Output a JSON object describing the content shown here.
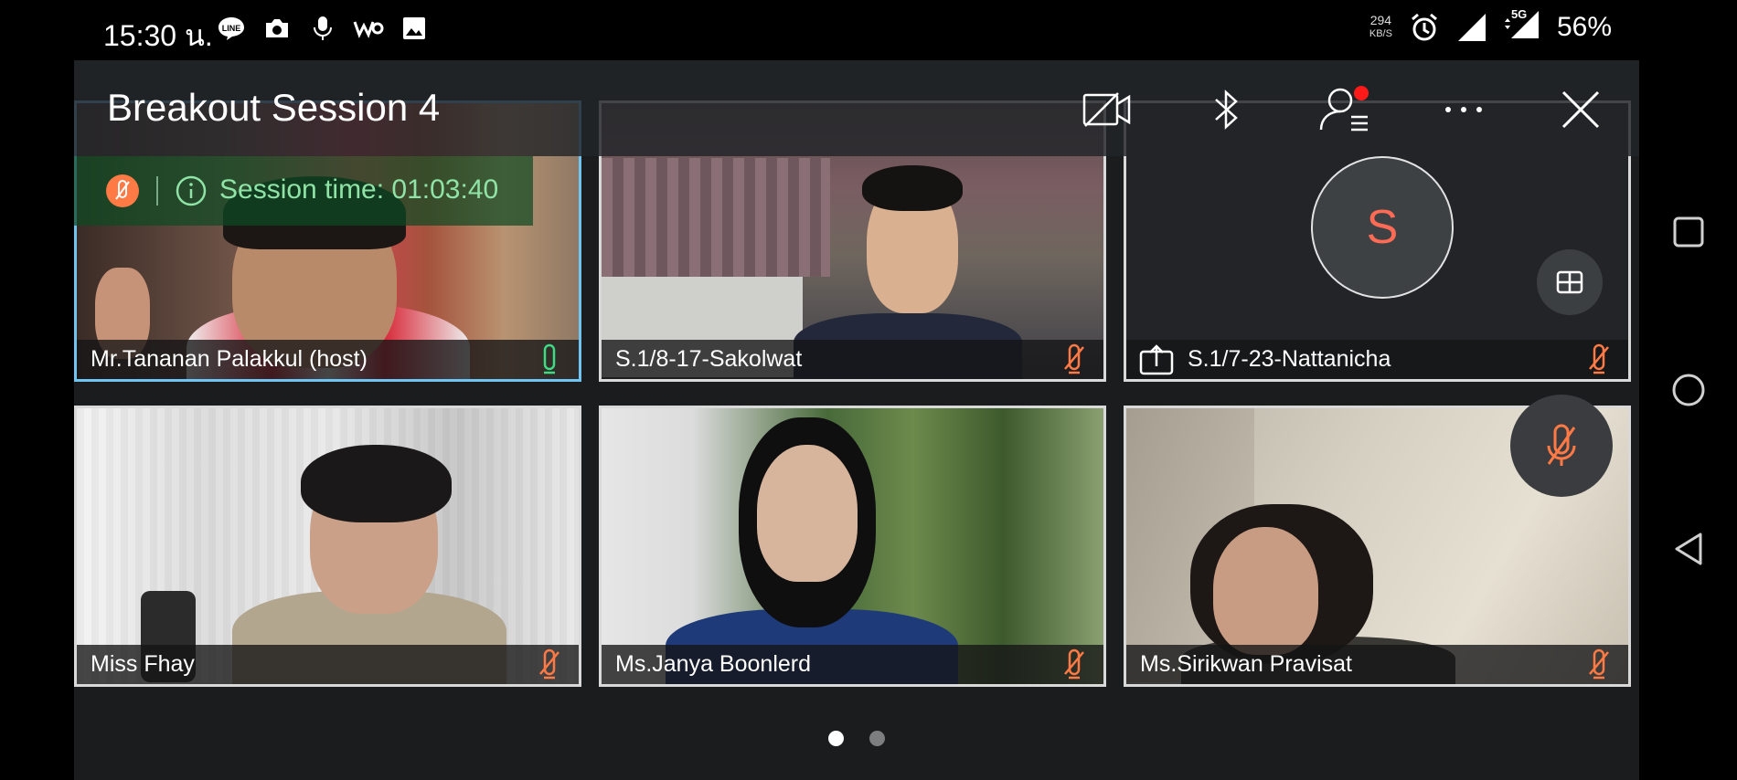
{
  "status_bar": {
    "time": "15:30 น.",
    "net_speed_value": "294",
    "net_speed_unit": "KB/S",
    "network": "5G",
    "battery": "56%",
    "icons": [
      "line-app-icon",
      "camera-icon",
      "microphone-icon",
      "webex-icon",
      "gallery-icon",
      "alarm-icon",
      "signal-icon",
      "signal-5g-icon"
    ]
  },
  "meeting": {
    "title": "Breakout Session 4",
    "toolbar": [
      "video-off-icon",
      "bluetooth-icon",
      "participants-icon",
      "more-icon",
      "close-icon"
    ],
    "session_label": "Session time:",
    "session_time": "01:03:40"
  },
  "participants": [
    {
      "name": "Mr.Tananan Palakkul (host)",
      "mic": "on"
    },
    {
      "name": "S.1/8-17-Sakolwat",
      "mic": "muted"
    },
    {
      "name": "S.1/7-23-Nattanicha",
      "mic": "muted",
      "avatar_initial": "S",
      "sharing": true
    },
    {
      "name": "Miss Fhay",
      "mic": "muted"
    },
    {
      "name": "Ms.Janya Boonlerd",
      "mic": "muted"
    },
    {
      "name": "Ms.Sirikwan Pravisat",
      "mic": "muted"
    }
  ],
  "pager": {
    "pages": 2,
    "current": 1
  },
  "colors": {
    "mic_on": "#3ddc84",
    "mic_muted": "#ff7a45",
    "host_border": "#6fc4f2",
    "tile_border": "#d9d9d9",
    "session_text": "#8fe3a6",
    "notification_dot": "#ff1a1a"
  },
  "nav": [
    "recents-square-icon",
    "home-circle-icon",
    "back-triangle-icon"
  ]
}
